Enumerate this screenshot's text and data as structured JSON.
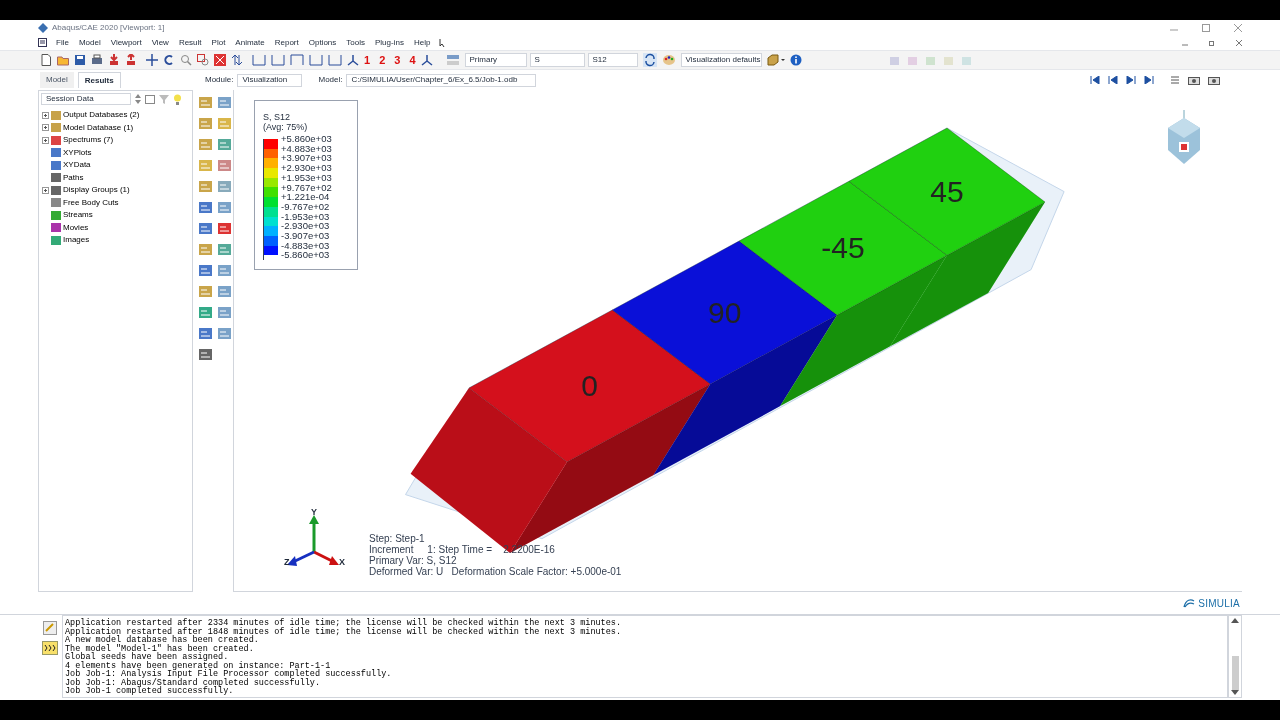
{
  "window": {
    "title": "Abaqus/CAE 2020 [Viewport: 1]"
  },
  "menu": [
    "File",
    "Model",
    "Viewport",
    "View",
    "Result",
    "Plot",
    "Animate",
    "Report",
    "Options",
    "Tools",
    "Plug-ins",
    "Help"
  ],
  "toolbar": {
    "view_numbers": [
      "1",
      "2",
      "3",
      "4"
    ],
    "combos": [
      {
        "value": "Primary"
      },
      {
        "value": "S"
      },
      {
        "value": "S12"
      }
    ],
    "options": {
      "value": "Visualization defaults"
    }
  },
  "tabs": [
    {
      "label": "Model",
      "selected": false
    },
    {
      "label": "Results",
      "selected": true
    }
  ],
  "context_bar": {
    "module_label": "Module:",
    "module": "Visualization",
    "model_label": "Model:",
    "model": "C:/SIMULIA/User/Chapter_6/Ex_6.5/Job-1.odb"
  },
  "tree": {
    "filter": "Session Data",
    "items": [
      {
        "label": "Output Databases (2)",
        "expandable": true
      },
      {
        "label": "Model Database (1)",
        "expandable": true
      },
      {
        "label": "Spectrums (7)",
        "expandable": true
      },
      {
        "label": "XYPlots",
        "expandable": false
      },
      {
        "label": "XYData",
        "expandable": false
      },
      {
        "label": "Paths",
        "expandable": false
      },
      {
        "label": "Display Groups (1)",
        "expandable": true
      },
      {
        "label": "Free Body Cuts",
        "expandable": false
      },
      {
        "label": "Streams",
        "expandable": false
      },
      {
        "label": "Movies",
        "expandable": false
      },
      {
        "label": "Images",
        "expandable": false
      }
    ]
  },
  "legend": {
    "title": "S, S12",
    "subtitle": "(Avg: 75%)",
    "bands": [
      {
        "color": "#ff0000"
      },
      {
        "color": "#ff6000"
      },
      {
        "color": "#ffb000"
      },
      {
        "color": "#e8e800"
      },
      {
        "color": "#98e800"
      },
      {
        "color": "#40e000"
      },
      {
        "color": "#00e030"
      },
      {
        "color": "#00e090"
      },
      {
        "color": "#00e0d0"
      },
      {
        "color": "#00b0ff"
      },
      {
        "color": "#0060ff"
      },
      {
        "color": "#0010ff"
      }
    ],
    "values": [
      "+5.860e+03",
      "+4.883e+03",
      "+3.907e+03",
      "+2.930e+03",
      "+1.953e+03",
      "+9.767e+02",
      "+1.221e-04",
      "-9.767e+02",
      "-1.953e+03",
      "-2.930e+03",
      "-3.907e+03",
      "-4.883e+03",
      "-5.860e+03"
    ]
  },
  "model": {
    "plies": [
      {
        "label": "0",
        "color": "#d4101c"
      },
      {
        "label": "90",
        "color": "#0a10d8"
      },
      {
        "label": "-45",
        "color": "#20d010"
      },
      {
        "label": "45",
        "color": "#20d010"
      }
    ]
  },
  "triad": {
    "x": "X",
    "y": "Y",
    "z": "Z"
  },
  "info": [
    "Step: Step-1",
    "Increment     1: Step Time =    2.2200E-16",
    "Primary Var: S, S12",
    "Deformed Var: U   Deformation Scale Factor: +5.000e-01"
  ],
  "brand": "SIMULIA",
  "messages": [
    "Application restarted after 2334 minutes of idle time; the license will be checked within the next 3 minutes.",
    "Application restarted after 1848 minutes of idle time; the license will be checked within the next 3 minutes.",
    "A new model database has been created.",
    "The model \"Model-1\" has been created.",
    "Global seeds have been assigned.",
    "4 elements have been generated on instance: Part-1-1",
    "Job Job-1: Analysis Input File Processor completed successfully.",
    "Job Job-1: Abaqus/Standard completed successfully.",
    "Job Job-1 completed successfully."
  ]
}
